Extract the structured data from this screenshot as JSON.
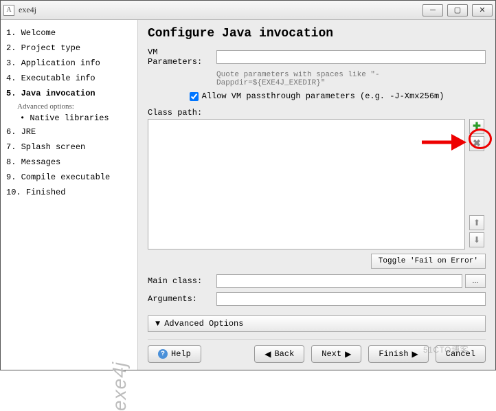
{
  "window": {
    "title": "exe4j"
  },
  "sidebar": {
    "steps": [
      {
        "n": "1.",
        "label": "Welcome"
      },
      {
        "n": "2.",
        "label": "Project type"
      },
      {
        "n": "3.",
        "label": "Application info"
      },
      {
        "n": "4.",
        "label": "Executable info"
      },
      {
        "n": "5.",
        "label": "Java invocation",
        "selected": true
      },
      {
        "n": "6.",
        "label": "JRE"
      },
      {
        "n": "7.",
        "label": "Splash screen"
      },
      {
        "n": "8.",
        "label": "Messages"
      },
      {
        "n": "9.",
        "label": "Compile executable"
      },
      {
        "n": "10.",
        "label": "Finished"
      }
    ],
    "advanced_label": "Advanced options:",
    "advanced_item": "Native libraries",
    "logo": "exe4j"
  },
  "main": {
    "heading": "Configure Java invocation",
    "vm_params_label": "VM Parameters:",
    "vm_params_value": "",
    "vm_hint": "Quote parameters with spaces like \"-Dappdir=${EXE4J_EXEDIR}\"",
    "passthrough_label": "Allow VM passthrough parameters (e.g. -J-Xmx256m)",
    "classpath_label": "Class path:",
    "toggle_label": "Toggle 'Fail on Error'",
    "mainclass_label": "Main class:",
    "mainclass_value": "",
    "arguments_label": "Arguments:",
    "arguments_value": "",
    "advanced_btn": "Advanced Options"
  },
  "footer": {
    "help": "Help",
    "back": "Back",
    "next": "Next",
    "finish": "Finish",
    "cancel": "Cancel"
  },
  "watermark": "51CTO博客"
}
